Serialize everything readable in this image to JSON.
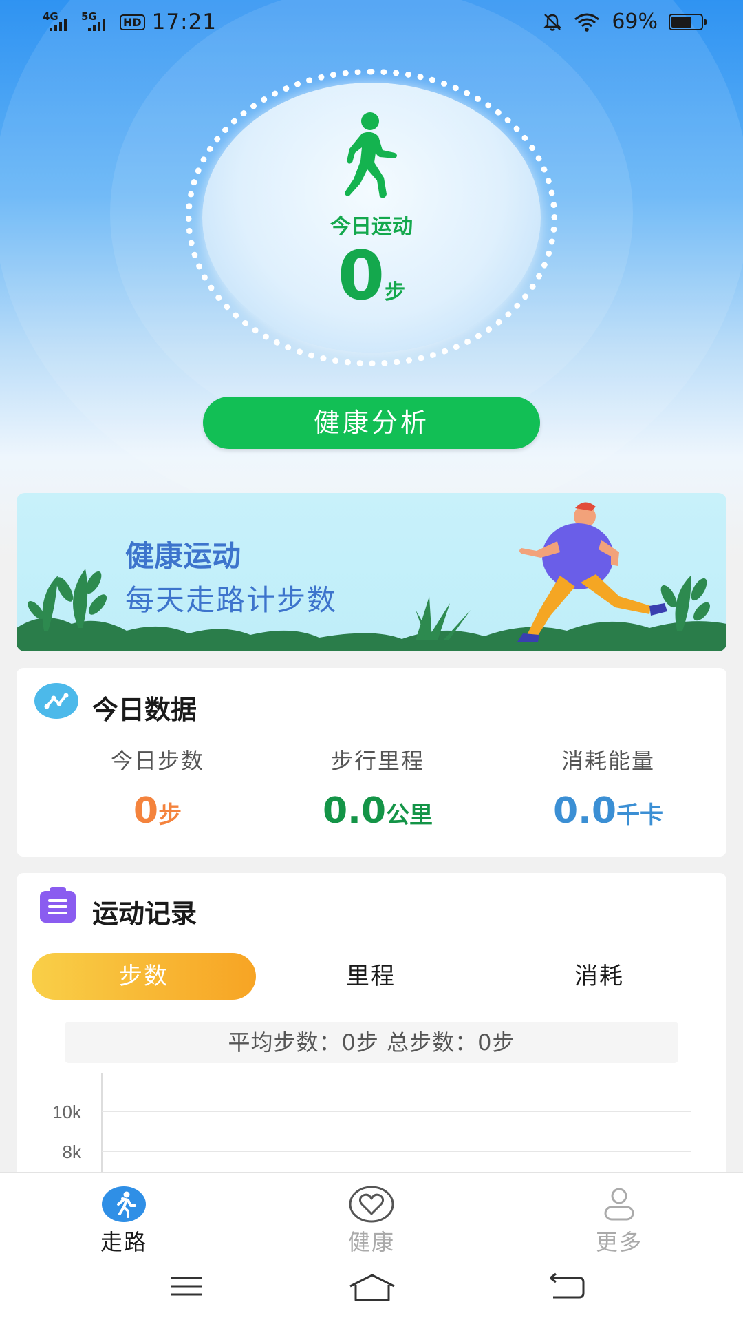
{
  "status_bar": {
    "network1": "4G",
    "network2": "5G",
    "hd": "HD",
    "time": "17:21",
    "battery": "69%",
    "icons": [
      "signal-icon",
      "hd-icon",
      "mute-icon",
      "wifi-icon",
      "battery-icon"
    ]
  },
  "hero": {
    "label": "今日运动",
    "steps_value": "0",
    "steps_unit": "步",
    "analysis_button": "健康分析",
    "icon": "walker-icon"
  },
  "banner": {
    "title": "健康运动",
    "subtitle": "每天走路计步数"
  },
  "today_data": {
    "title": "今日数据",
    "icon": "chart-line-icon",
    "stats": [
      {
        "label": "今日步数",
        "value": "0",
        "unit": "步",
        "color": "#f4833d"
      },
      {
        "label": "步行里程",
        "value": "0.0",
        "unit": "公里",
        "color": "#149447"
      },
      {
        "label": "消耗能量",
        "value": "0.0",
        "unit": "千卡",
        "color": "#3b8fd4"
      }
    ]
  },
  "records": {
    "title": "运动记录",
    "icon": "clipboard-icon",
    "tabs": [
      "步数",
      "里程",
      "消耗"
    ],
    "active_tab": 0,
    "summary": "平均步数：0步  总步数：0步",
    "chart": {
      "ticks": [
        "10k",
        "8k"
      ]
    }
  },
  "chart_data": {
    "type": "bar",
    "categories": [],
    "values": [],
    "title": "",
    "ylabel": "",
    "yticks": [
      "10k",
      "8k"
    ]
  },
  "bottom_nav": {
    "items": [
      {
        "label": "走路",
        "icon": "walk-icon",
        "active": true
      },
      {
        "label": "健康",
        "icon": "heart-icon",
        "active": false
      },
      {
        "label": "更多",
        "icon": "user-icon",
        "active": false
      }
    ]
  },
  "system_nav": [
    "menu-icon",
    "home-icon",
    "back-icon"
  ],
  "colors": {
    "brand_green": "#12bf55",
    "accent_orange": "#f7a424",
    "sky_blue": "#2f93f2"
  }
}
